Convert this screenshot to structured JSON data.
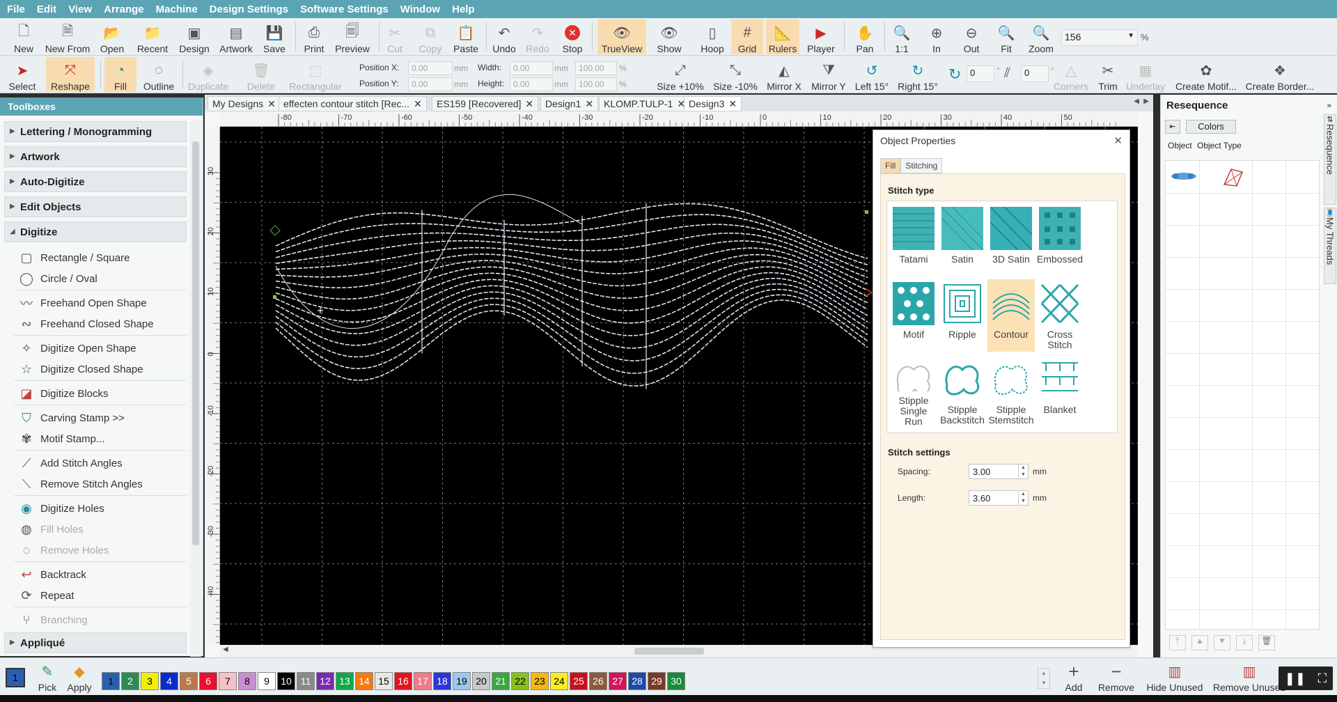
{
  "menu": [
    "File",
    "Edit",
    "View",
    "Arrange",
    "Machine",
    "Design Settings",
    "Software Settings",
    "Window",
    "Help"
  ],
  "toolbar1": {
    "new": "New",
    "new_from": "New From",
    "open": "Open",
    "recent": "Recent",
    "design": "Design",
    "artwork": "Artwork",
    "save": "Save",
    "print": "Print",
    "preview": "Preview",
    "cut": "Cut",
    "copy": "Copy",
    "paste": "Paste",
    "undo": "Undo",
    "redo": "Redo",
    "stop": "Stop",
    "trueview": "TrueView",
    "show": "Show",
    "hoop": "Hoop",
    "grid": "Grid",
    "rulers": "Rulers",
    "player": "Player",
    "pan": "Pan",
    "one_to_one": "1:1",
    "zoom_in": "In",
    "zoom_out": "Out",
    "fit": "Fit",
    "zoom": "Zoom",
    "zoom_value": "156",
    "zoom_unit": "%"
  },
  "toolbar2": {
    "select": "Select",
    "reshape": "Reshape",
    "fill": "Fill",
    "outline": "Outline",
    "duplicate": "Duplicate",
    "delete": "Delete",
    "rectangular": "Rectangular",
    "pos_x_label": "Position X:",
    "pos_x": "0.00",
    "pos_y_label": "Position Y:",
    "pos_y": "0.00",
    "mm": "mm",
    "width_label": "Width:",
    "width": "0.00",
    "height_label": "Height:",
    "height": "0.00",
    "pct_w": "100.00",
    "pct_h": "100.00",
    "pct": "%",
    "size_up": "Size +10%",
    "size_down": "Size -10%",
    "mirror_x": "Mirror X",
    "mirror_y": "Mirror Y",
    "left15": "Left 15°",
    "right15": "Right 15°",
    "rotate_value": "0",
    "slant_value": "0",
    "deg": "°",
    "corners": "Corners",
    "trim": "Trim",
    "underlay": "Underlay",
    "create_motif": "Create Motif...",
    "create_border": "Create Border..."
  },
  "toolboxes": {
    "title": "Toolboxes",
    "categories": {
      "lettering": "Lettering / Monogramming",
      "artwork": "Artwork",
      "auto": "Auto-Digitize",
      "edit": "Edit Objects",
      "digitize": "Digitize",
      "applique": "Appliqué"
    },
    "items": [
      "Rectangle / Square",
      "Circle / Oval",
      "Freehand Open Shape",
      "Freehand Closed Shape",
      "Digitize Open Shape",
      "Digitize Closed Shape",
      "Digitize Blocks",
      "Carving Stamp >>",
      "Motif Stamp...",
      "Add Stitch Angles",
      "Remove Stitch Angles",
      "Digitize Holes",
      "Fill Holes",
      "Remove Holes",
      "Backtrack",
      "Repeat",
      "Branching"
    ]
  },
  "tabs": [
    "My Designs",
    "effecten contour stitch [Rec...",
    "ES159 [Recovered]",
    "Design1",
    "KLOMP.TULP-1",
    "Design3"
  ],
  "ruler_h": [
    "-80",
    "-70",
    "-60",
    "-50",
    "-40",
    "-30",
    "-20",
    "-10",
    "0",
    "10",
    "20",
    "30",
    "40",
    "50"
  ],
  "ruler_v": [
    "30",
    "20",
    "10",
    "0",
    "-10",
    "-20",
    "-30",
    "-40"
  ],
  "object_properties": {
    "title": "Object Properties",
    "tab_fill": "Fill",
    "tab_stitching": "Stitching",
    "stitch_type_label": "Stitch type",
    "types": [
      "Tatami",
      "Satin",
      "3D Satin",
      "Embossed",
      "Motif",
      "Ripple",
      "Contour",
      "Cross Stitch",
      "Stipple Single Run",
      "Stipple Backstitch",
      "Stipple Stemstitch",
      "Blanket"
    ],
    "selected": "Contour",
    "stitch_settings_label": "Stitch settings",
    "spacing_label": "Spacing:",
    "spacing": "3.00",
    "length_label": "Length:",
    "length": "3.60",
    "unit": "mm"
  },
  "resequence": {
    "title": "Resequence",
    "colors": "Colors",
    "col_object": "Object",
    "col_type": "Object Type",
    "side_resequence": "Resequence",
    "side_threads": "My Threads"
  },
  "bottom": {
    "pick": "Pick",
    "apply": "Apply",
    "add": "Add",
    "remove": "Remove",
    "hide_unused": "Hide Unused",
    "remove_unused": "Remove Unused",
    "current_color": "1",
    "swatches": [
      {
        "n": "1",
        "c": "#2a5fb0",
        "t": "#000"
      },
      {
        "n": "2",
        "c": "#2e8b57",
        "t": "#fff"
      },
      {
        "n": "3",
        "c": "#f2ef00",
        "t": "#000"
      },
      {
        "n": "4",
        "c": "#0a2acc",
        "t": "#fff"
      },
      {
        "n": "5",
        "c": "#b97a4a",
        "t": "#fff"
      },
      {
        "n": "6",
        "c": "#e8102c",
        "t": "#fff"
      },
      {
        "n": "7",
        "c": "#f6c0c8",
        "t": "#000"
      },
      {
        "n": "8",
        "c": "#c790d0",
        "t": "#000"
      },
      {
        "n": "9",
        "c": "#ffffff",
        "t": "#000"
      },
      {
        "n": "10",
        "c": "#000000",
        "t": "#fff"
      },
      {
        "n": "11",
        "c": "#8a8a8a",
        "t": "#fff"
      },
      {
        "n": "12",
        "c": "#7a2cb0",
        "t": "#fff"
      },
      {
        "n": "13",
        "c": "#11a84a",
        "t": "#fff"
      },
      {
        "n": "14",
        "c": "#f57a10",
        "t": "#fff"
      },
      {
        "n": "15",
        "c": "#e8e8e8",
        "t": "#000"
      },
      {
        "n": "16",
        "c": "#e4141e",
        "t": "#fff"
      },
      {
        "n": "17",
        "c": "#f07a8a",
        "t": "#fff"
      },
      {
        "n": "18",
        "c": "#2a36d6",
        "t": "#fff"
      },
      {
        "n": "19",
        "c": "#9cc8ec",
        "t": "#000"
      },
      {
        "n": "20",
        "c": "#c9c9c9",
        "t": "#000"
      },
      {
        "n": "21",
        "c": "#3aa640",
        "t": "#fff"
      },
      {
        "n": "22",
        "c": "#86c21c",
        "t": "#000"
      },
      {
        "n": "23",
        "c": "#f6b80e",
        "t": "#000"
      },
      {
        "n": "24",
        "c": "#faee20",
        "t": "#000"
      },
      {
        "n": "25",
        "c": "#c8101c",
        "t": "#fff"
      },
      {
        "n": "26",
        "c": "#8a5a3a",
        "t": "#fff"
      },
      {
        "n": "27",
        "c": "#d4145a",
        "t": "#fff"
      },
      {
        "n": "28",
        "c": "#1c4aa8",
        "t": "#fff"
      },
      {
        "n": "29",
        "c": "#7a3a2a",
        "t": "#fff"
      },
      {
        "n": "30",
        "c": "#1a8a3a",
        "t": "#fff"
      }
    ]
  },
  "colors": {
    "accent": "#5aa4b3",
    "selected": "#f8dcb0",
    "stitch": "#dce6f0"
  }
}
